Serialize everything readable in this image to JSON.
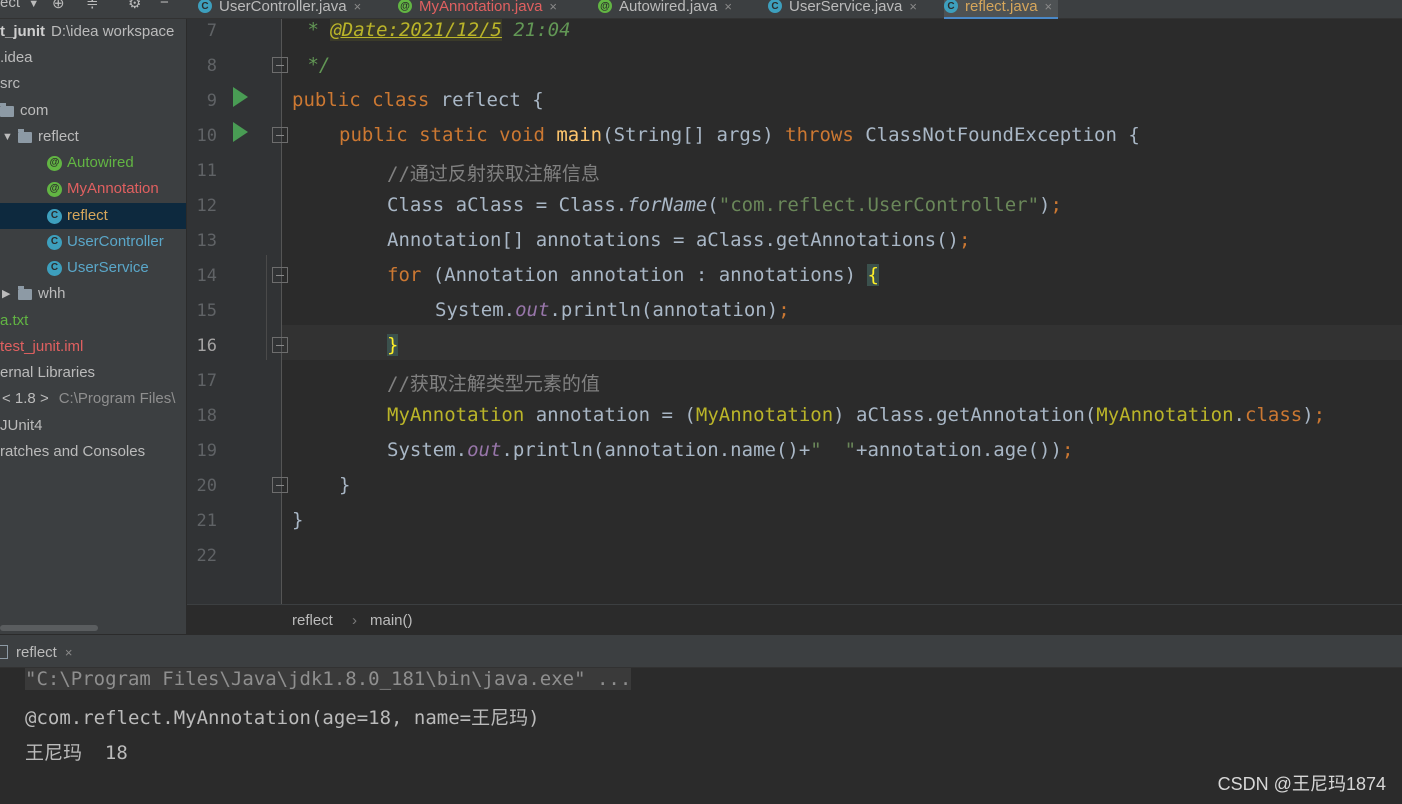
{
  "toolbar": {
    "project_label": "ect",
    "icons": [
      "chevron-down-icon",
      "target-icon",
      "collapse-icon",
      "gear-icon",
      "minimize-icon"
    ]
  },
  "tabs": [
    {
      "label": "UserController.java",
      "icon": "C",
      "active": false
    },
    {
      "label": "MyAnnotation.java",
      "icon": "@",
      "active": false
    },
    {
      "label": "Autowired.java",
      "icon": "@",
      "active": false
    },
    {
      "label": "UserService.java",
      "icon": "C",
      "active": false
    },
    {
      "label": "reflect.java",
      "icon": "C",
      "active": true
    }
  ],
  "tree": {
    "root_name": "t_junit",
    "root_path": "D:\\idea workspace",
    "idea": ".idea",
    "src": "src",
    "com": "com",
    "reflect_pkg": "reflect",
    "autowired": "Autowired",
    "myannotation": "MyAnnotation",
    "reflect_class": "reflect",
    "usercontroller": "UserController",
    "userservice": "UserService",
    "whh": "whh",
    "atxt": "a.txt",
    "iml": "test_junit.iml",
    "ext_libs": "ernal Libraries",
    "jdk": "< 1.8 >",
    "jdk_path": "C:\\Program Files\\",
    "junit": "JUnit4",
    "scratches": "ratches and Consoles"
  },
  "editor": {
    "line_numbers": [
      "7",
      "8",
      "9",
      "10",
      "11",
      "12",
      "13",
      "14",
      "15",
      "16",
      "17",
      "18",
      "19",
      "20",
      "21",
      "22"
    ],
    "current_line": "16",
    "code": {
      "l7_star": " * ",
      "l7_tag": "@Date:2021/12/5",
      "l7_time": " 21:04",
      "l8": " */",
      "l9_kw": "public class",
      "l9_rest": " reflect {",
      "l10_kw": "public static void",
      "l10_fn": "main",
      "l10_args": "(String[] args) ",
      "l10_throws": "throws",
      "l10_rest": " ClassNotFoundException {",
      "l11": "//通过反射获取注解信息",
      "l12_a": "Class aClass = Class.",
      "l12_fn": "forName",
      "l12_p": "(",
      "l12_str": "\"com.reflect.UserController\"",
      "l12_e": ")",
      "l12_semi": ";",
      "l13_a": "Annotation[] annotations = aClass.getAnnotations()",
      "l13_semi": ";",
      "l14_kw": "for",
      "l14_rest": " (Annotation annotation : annotations) ",
      "l14_brace": "{",
      "l15_a": "System.",
      "l15_out": "out",
      "l15_b": ".println(annotation)",
      "l15_semi": ";",
      "l16_brace": "}",
      "l17": "//获取注解类型元素的值",
      "l18_ann": "MyAnnotation",
      "l18_a": " annotation = (",
      "l18_ann2": "MyAnnotation",
      "l18_b": ") aClass.getAnnotation(",
      "l18_ann3": "MyAnnotation",
      "l18_c": ".",
      "l18_kw": "class",
      "l18_d": ")",
      "l18_semi": ";",
      "l19_a": "System.",
      "l19_out": "out",
      "l19_b": ".println(annotation.name()+",
      "l19_str": "\"  \"",
      "l19_c": "+annotation.age())",
      "l19_semi": ";",
      "l20": "}",
      "l21": "}"
    }
  },
  "breadcrumb": {
    "class": "reflect",
    "sep": "›",
    "method": "main()"
  },
  "run": {
    "tab_label": "reflect",
    "lines": [
      "\"C:\\Program Files\\Java\\jdk1.8.0_181\\bin\\java.exe\" ...",
      "@com.reflect.MyAnnotation(age=18, name=王尼玛)",
      "王尼玛  18"
    ]
  },
  "watermark": "CSDN @王尼玛1874",
  "colors": {
    "keyword": "#cc7832",
    "function": "#ffc66d",
    "string": "#6a8759",
    "comment": "#808080",
    "annotation": "#bbb529",
    "field": "#9876aa",
    "background": "#2b2b2b"
  }
}
